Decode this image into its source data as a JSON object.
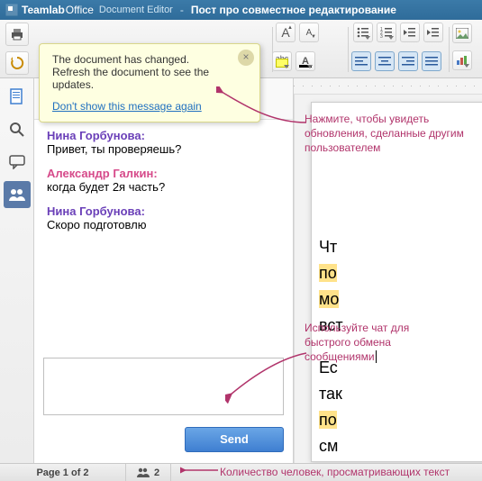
{
  "titlebar": {
    "brand1": "Teamlab",
    "brand2": "Office",
    "product": "Document Editor",
    "dash": "-",
    "docname": "Пост про совместное редактирование"
  },
  "toolbar": {
    "font_inc": "A",
    "font_dec": "A",
    "hl_label": "abc",
    "fc_label": "A",
    "align_left": "≡",
    "align_center": "≡",
    "align_right": "≡",
    "align_just": "≡"
  },
  "rail": {
    "file": "file-icon",
    "search": "search-icon",
    "comments": "comment-icon",
    "chat": "users-icon"
  },
  "panel": {
    "users": [
      {
        "name": "Александр Галкин",
        "color": "chip-pink"
      },
      {
        "name": "Нина Горбунова",
        "color": "chip-purple"
      }
    ],
    "messages": [
      {
        "author": "Нина Горбунова:",
        "cls": "purple",
        "text": "Привет, ты проверяешь?"
      },
      {
        "author": "Александр Галкин:",
        "cls": "pink",
        "text": "когда будет 2я часть?"
      },
      {
        "author": "Нина Горбунова:",
        "cls": "purple",
        "text": "Скоро подготовлю"
      }
    ],
    "input_value": "",
    "send": "Send"
  },
  "notif": {
    "line1": "The document has changed.",
    "line2": "Refresh the document to see the updates.",
    "link": "Don't show this message again",
    "close": "×"
  },
  "doc": {
    "l1a": "Чт",
    "l2a": "по",
    "l3a": "мо",
    "l4a": "вст",
    "l5a": "Ес",
    "l6a": "так",
    "l7a": "по",
    "l8a": "см"
  },
  "annot": {
    "a1": "Нажмите, чтобы увидеть обновления, сделанные другим пользователем",
    "a2": "Используйте чат для быстрого обмена сообщениями",
    "a3": "Количество человек, просматривающих текст"
  },
  "status": {
    "page": "Page 1 of 2",
    "users_count": "2"
  }
}
